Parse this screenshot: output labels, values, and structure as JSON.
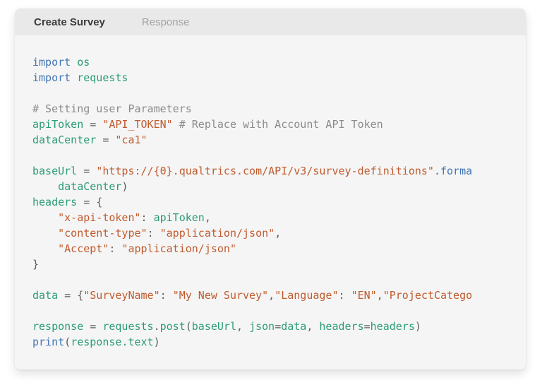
{
  "tabs": [
    {
      "label": "Create Survey",
      "active": true
    },
    {
      "label": "Response",
      "active": false
    }
  ],
  "colors": {
    "page-bg": "#ffffff",
    "card-bg": "#f5f5f5",
    "tabbar-bg": "#e9e9e9",
    "tab-active": "#3d3d3d",
    "tab-inactive": "#a3a3a3",
    "keyword": "#4476b4",
    "identifier": "#2b9c77",
    "string": "#c05b2e",
    "comment": "#8b8b8b",
    "plain": "#5c5e5d"
  },
  "code": {
    "language": "python",
    "lines": [
      [
        [
          "kw",
          "import"
        ],
        [
          "pln",
          " "
        ],
        [
          "id",
          "os"
        ]
      ],
      [
        [
          "kw",
          "import"
        ],
        [
          "pln",
          " "
        ],
        [
          "id",
          "requests"
        ]
      ],
      [],
      [
        [
          "com",
          "# Setting user Parameters"
        ]
      ],
      [
        [
          "id",
          "apiToken"
        ],
        [
          "pln",
          " = "
        ],
        [
          "str",
          "\"API_TOKEN\""
        ],
        [
          "com",
          " # Replace with Account API Token"
        ]
      ],
      [
        [
          "id",
          "dataCenter"
        ],
        [
          "pln",
          " = "
        ],
        [
          "str",
          "\"ca1\""
        ]
      ],
      [],
      [
        [
          "id",
          "baseUrl"
        ],
        [
          "pln",
          " = "
        ],
        [
          "str",
          "\"https://{0}.qualtrics.com/API/v3/survey-definitions\""
        ],
        [
          "pln",
          "."
        ],
        [
          "kw",
          "forma"
        ]
      ],
      [
        [
          "pln",
          "    "
        ],
        [
          "id",
          "dataCenter"
        ],
        [
          "pln",
          ")"
        ]
      ],
      [
        [
          "id",
          "headers"
        ],
        [
          "pln",
          " = {"
        ]
      ],
      [
        [
          "pln",
          "    "
        ],
        [
          "str",
          "\"x-api-token\""
        ],
        [
          "pln",
          ": "
        ],
        [
          "id",
          "apiToken"
        ],
        [
          "pln",
          ","
        ]
      ],
      [
        [
          "pln",
          "    "
        ],
        [
          "str",
          "\"content-type\""
        ],
        [
          "pln",
          ": "
        ],
        [
          "str",
          "\"application/json\""
        ],
        [
          "pln",
          ","
        ]
      ],
      [
        [
          "pln",
          "    "
        ],
        [
          "str",
          "\"Accept\""
        ],
        [
          "pln",
          ": "
        ],
        [
          "str",
          "\"application/json\""
        ]
      ],
      [
        [
          "pln",
          "}"
        ]
      ],
      [],
      [
        [
          "id",
          "data"
        ],
        [
          "pln",
          " = {"
        ],
        [
          "str",
          "\"SurveyName\""
        ],
        [
          "pln",
          ": "
        ],
        [
          "str",
          "\"My New Survey\""
        ],
        [
          "pln",
          ","
        ],
        [
          "str",
          "\"Language\""
        ],
        [
          "pln",
          ": "
        ],
        [
          "str",
          "\"EN\""
        ],
        [
          "pln",
          ","
        ],
        [
          "str",
          "\"ProjectCatego"
        ]
      ],
      [],
      [
        [
          "id",
          "response"
        ],
        [
          "pln",
          " = "
        ],
        [
          "id",
          "requests"
        ],
        [
          "pln",
          "."
        ],
        [
          "id",
          "post"
        ],
        [
          "pln",
          "("
        ],
        [
          "id",
          "baseUrl"
        ],
        [
          "pln",
          ", "
        ],
        [
          "id",
          "json"
        ],
        [
          "pln",
          "="
        ],
        [
          "id",
          "data"
        ],
        [
          "pln",
          ", "
        ],
        [
          "id",
          "headers"
        ],
        [
          "pln",
          "="
        ],
        [
          "id",
          "headers"
        ],
        [
          "pln",
          ")"
        ]
      ],
      [
        [
          "kw",
          "print"
        ],
        [
          "pln",
          "("
        ],
        [
          "id",
          "response.text"
        ],
        [
          "pln",
          ")"
        ]
      ]
    ]
  }
}
